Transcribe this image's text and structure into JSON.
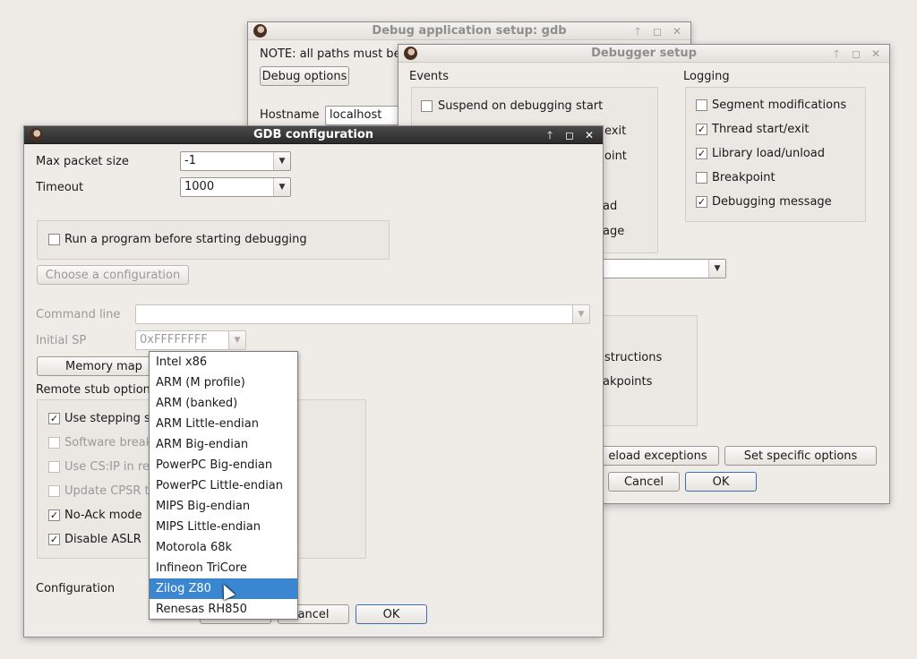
{
  "windows": {
    "debug_app": {
      "title": "Debug application setup: gdb",
      "note": "NOTE: all paths must be",
      "debug_options_label": "Debug options",
      "hostname_label": "Hostname",
      "hostname_value": "localhost"
    },
    "debugger_setup": {
      "title": "Debugger setup",
      "events_label": "Events",
      "suspend_label": "Suspend on debugging start",
      "partial_events": [
        "exit",
        "oint",
        "ad",
        "age"
      ],
      "logging_label": "Logging",
      "logging_items": [
        {
          "label": "Segment modifications",
          "checked": ""
        },
        {
          "label": "Thread start/exit",
          "checked": "✓"
        },
        {
          "label": "Library load/unload",
          "checked": "✓"
        },
        {
          "label": "Breakpoint",
          "checked": ""
        },
        {
          "label": "Debugging message",
          "checked": "✓"
        }
      ],
      "partial_options": [
        "structions",
        "akpoints"
      ],
      "reload_exceptions": "eload exceptions",
      "set_specific_options": "Set specific options",
      "cancel": "Cancel",
      "ok": "OK"
    },
    "gdb_config": {
      "title": "GDB configuration",
      "max_packet_label": "Max packet size",
      "max_packet_value": "-1",
      "timeout_label": "Timeout",
      "timeout_value": "1000",
      "run_program_label": "Run a program before starting debugging",
      "choose_config_label": "Choose a configuration",
      "command_line_label": "Command line",
      "command_line_value": "",
      "initial_sp_label": "Initial SP",
      "initial_sp_value": "0xFFFFFFFF",
      "memory_map_label": "Memory map",
      "remote_stub_label": "Remote stub option",
      "stub_options": [
        {
          "label": "Use stepping s",
          "checked": "✓",
          "enabled": true
        },
        {
          "label": "Software break",
          "checked": "",
          "enabled": false
        },
        {
          "label": "Use CS:IP in re",
          "checked": "",
          "enabled": false
        },
        {
          "label": "Update CPSR t",
          "checked": "",
          "enabled": false
        },
        {
          "label": "No-Ack mode",
          "checked": "✓",
          "enabled": true
        },
        {
          "label": "Disable ASLR",
          "checked": "✓",
          "enabled": true
        }
      ],
      "configuration_label": "Configuration",
      "cancel": "ancel",
      "ok": "OK"
    }
  },
  "dropdown": {
    "options": [
      "Intel x86",
      "ARM (M profile)",
      "ARM (banked)",
      "ARM Little-endian",
      "ARM Big-endian",
      "PowerPC Big-endian",
      "PowerPC Little-endian",
      "MIPS Big-endian",
      "MIPS Little-endian",
      "Motorola 68k",
      "Infineon TriCore",
      "Zilog Z80",
      "Renesas RH850"
    ],
    "selected_index": 11
  },
  "colors": {
    "selection": "#3a86d0",
    "active_titlebar": "#2b2b2b",
    "window_bg": "#efebe7"
  }
}
